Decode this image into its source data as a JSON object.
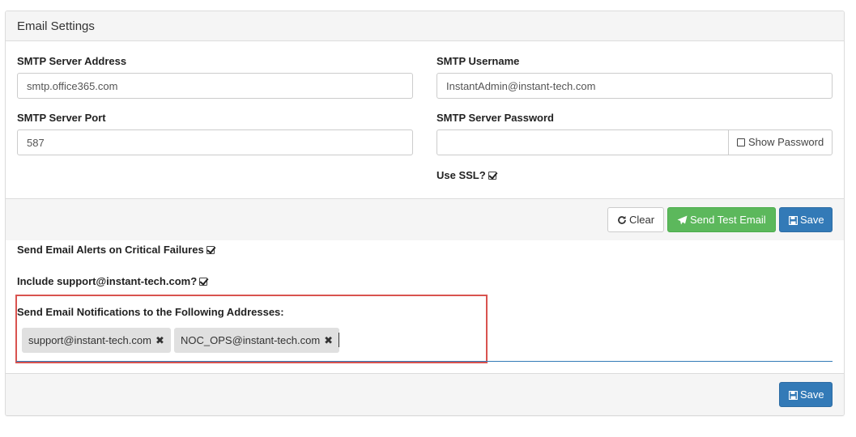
{
  "panel": {
    "title": "Email Settings"
  },
  "smtp": {
    "server_address_label": "SMTP Server Address",
    "server_address_value": "smtp.office365.com",
    "username_label": "SMTP Username",
    "username_value": "InstantAdmin@instant-tech.com",
    "port_label": "SMTP Server Port",
    "port_value": "587",
    "password_label": "SMTP Server Password",
    "password_value": "",
    "show_password_label": "Show Password",
    "show_password_checked": false,
    "use_ssl_label": "Use SSL?",
    "use_ssl_checked": true
  },
  "actions": {
    "clear_label": "Clear",
    "send_test_label": "Send Test Email",
    "save_label": "Save"
  },
  "alerts": {
    "critical_failures_label": "Send Email Alerts on Critical Failures",
    "critical_failures_checked": true,
    "include_support_label": "Include support@instant-tech.com?",
    "include_support_checked": true,
    "addresses_label": "Send Email Notifications to the Following Addresses:",
    "addresses": [
      "support@instant-tech.com",
      "NOC_OPS@instant-tech.com"
    ]
  },
  "footer": {
    "save_label": "Save"
  },
  "colors": {
    "primary": "#337ab7",
    "success": "#5cb85c",
    "highlight": "#d9534f"
  },
  "icons": {
    "clear": "refresh-icon",
    "send": "paper-plane-icon",
    "save": "floppy-disk-icon",
    "remove": "close-icon"
  }
}
